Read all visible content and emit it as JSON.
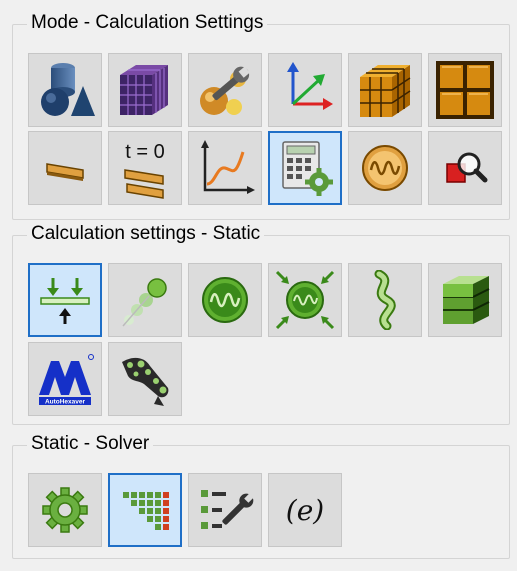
{
  "groups": {
    "mode": {
      "title": "Mode - Calculation Settings"
    },
    "static": {
      "title": "Calculation settings - Static"
    },
    "solver": {
      "title": "Static - Solver"
    }
  },
  "mode_buttons": [
    {
      "icon": "geometry-shapes-icon",
      "selected": false
    },
    {
      "icon": "mesh-cube-icon",
      "selected": false
    },
    {
      "icon": "material-properties-wrench-icon",
      "selected": false
    },
    {
      "icon": "coordinate-axes-icon",
      "selected": false
    },
    {
      "icon": "solid-mesh-cube-icon",
      "selected": false
    },
    {
      "icon": "grid-frame-icon",
      "selected": false
    },
    {
      "icon": "plate-element-icon",
      "selected": false
    },
    {
      "icon": "initial-time-t0-icon",
      "selected": false,
      "label": "t = 0"
    },
    {
      "icon": "curve-graph-icon",
      "selected": false
    },
    {
      "icon": "calculation-settings-calculator-icon",
      "selected": true
    },
    {
      "icon": "vibration-modes-icon",
      "selected": false
    },
    {
      "icon": "result-inspect-magnifier-icon",
      "selected": false
    }
  ],
  "static_buttons": [
    {
      "icon": "static-load-arrows-icon",
      "selected": true
    },
    {
      "icon": "nonlinear-beads-icon",
      "selected": false
    },
    {
      "icon": "modal-oscillation-icon",
      "selected": false
    },
    {
      "icon": "prestressed-modal-icon",
      "selected": false
    },
    {
      "icon": "buckling-twist-icon",
      "selected": false
    },
    {
      "icon": "layered-block-icon",
      "selected": false
    },
    {
      "icon": "autodesk-logo-icon",
      "selected": false,
      "label": "AutoHexaver"
    },
    {
      "icon": "frame-structure-icon",
      "selected": false
    }
  ],
  "solver_buttons": [
    {
      "icon": "solver-gear-icon",
      "selected": false
    },
    {
      "icon": "sparse-matrix-icon",
      "selected": true
    },
    {
      "icon": "solver-tools-list-icon",
      "selected": false
    },
    {
      "icon": "expression-e-icon",
      "selected": false,
      "label": "(e)"
    }
  ]
}
